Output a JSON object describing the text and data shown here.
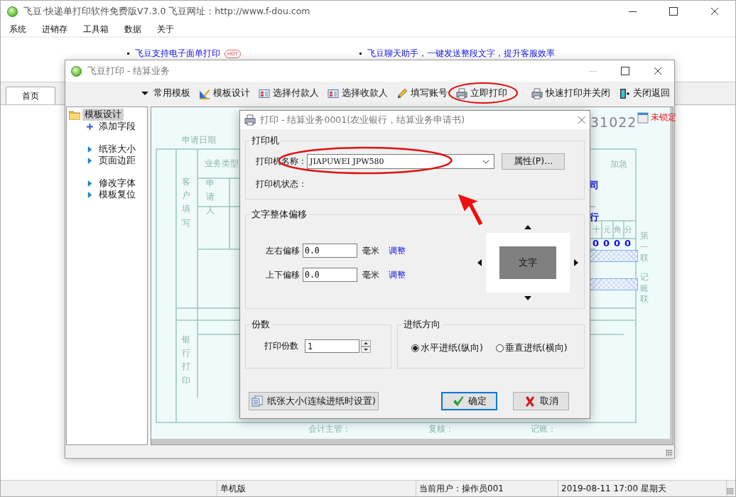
{
  "app_window": {
    "title": "飞豆·快递单打印软件免费版V7.3.0  飞豆网址：http://www.f-dou.com",
    "menu": [
      "系统",
      "进销存",
      "工具箱",
      "数据",
      "关于"
    ],
    "news": [
      {
        "text": "飞豆支持电子面单打印",
        "badge": "HOT"
      },
      {
        "text": "飞豆聊天助手，一键发送整段文字，提升客服效率"
      }
    ],
    "tabs": [
      {
        "label": "首页",
        "selected": true
      }
    ]
  },
  "child_window": {
    "title": "飞豆打印 - 结算业务",
    "toolbar": [
      {
        "label": "常用模板",
        "kind": "caret",
        "circled": false
      },
      {
        "label": "模板设计",
        "kind": "ruler",
        "circled": false
      },
      {
        "label": "选择付款人",
        "kind": "card",
        "circled": false
      },
      {
        "label": "选择收款人",
        "kind": "card",
        "circled": false
      },
      {
        "label": "填写账号",
        "kind": "pencil",
        "circled": false
      },
      {
        "label": "立即打印",
        "kind": "printer",
        "circled": true
      },
      {
        "label": "快速打印并关闭",
        "kind": "printer",
        "circled": false
      },
      {
        "label": "关闭返回",
        "kind": "door",
        "circled": false
      }
    ],
    "tree": {
      "label": "模板设计",
      "selected": true,
      "sections": [
        {
          "children": [
            {
              "label": "添加字段",
              "kind": "plus"
            }
          ]
        },
        {
          "children": [
            {
              "label": "纸张大小",
              "kind": "arrow"
            },
            {
              "label": "页面边距",
              "kind": "arrow"
            }
          ]
        },
        {
          "children": [
            {
              "label": "修改字体",
              "kind": "arrow"
            },
            {
              "label": "模板复位",
              "kind": "arrow"
            }
          ]
        }
      ]
    },
    "form": {
      "number": "31022",
      "lock_status": "未锁定",
      "labels": [
        "申请日期",
        "业务类型",
        "申请人",
        "客户填写",
        "银行打印",
        "加急"
      ],
      "fields": [
        "司",
        "行"
      ],
      "amount_units": [
        "十",
        "元",
        "角",
        "分"
      ],
      "amount_digits": [
        "0",
        "0",
        "0",
        "0"
      ],
      "side_note": [
        "第一联",
        "记账联"
      ],
      "footer": [
        "会计主管：",
        "复核：",
        "记账："
      ]
    }
  },
  "dialog": {
    "title": "打印 - 结算业务0001(农业银行，结算业务申请书)",
    "printer": {
      "legend": "打印机",
      "name_label": "打印机名称：",
      "name_value": "JIAPUWEI JPW580",
      "name_circled": true,
      "properties_button": "属性(P)...",
      "status_label": "打印机状态："
    },
    "offset": {
      "legend": "文字整体偏移",
      "rows": [
        {
          "label": "左右偏移",
          "value": "0.0",
          "unit": "毫米",
          "link": "调整"
        },
        {
          "label": "上下偏移",
          "value": "0.0",
          "unit": "毫米",
          "link": "调整"
        }
      ],
      "preview": "文字"
    },
    "copies": {
      "legend": "份数",
      "label": "打印份数",
      "value": "1"
    },
    "feed": {
      "legend": "进纸方向",
      "options": [
        {
          "label": "水平进纸(纵向)",
          "selected": true
        },
        {
          "label": "垂直进纸(横向)",
          "selected": false
        }
      ]
    },
    "buttons": {
      "paper": "纸张大小(连续进纸时设置)",
      "ok": "确定",
      "cancel": "取消"
    }
  },
  "status_bar": [
    "单机版",
    "当前用户：操作员001",
    "2019-08-11 17:00 星期天"
  ]
}
